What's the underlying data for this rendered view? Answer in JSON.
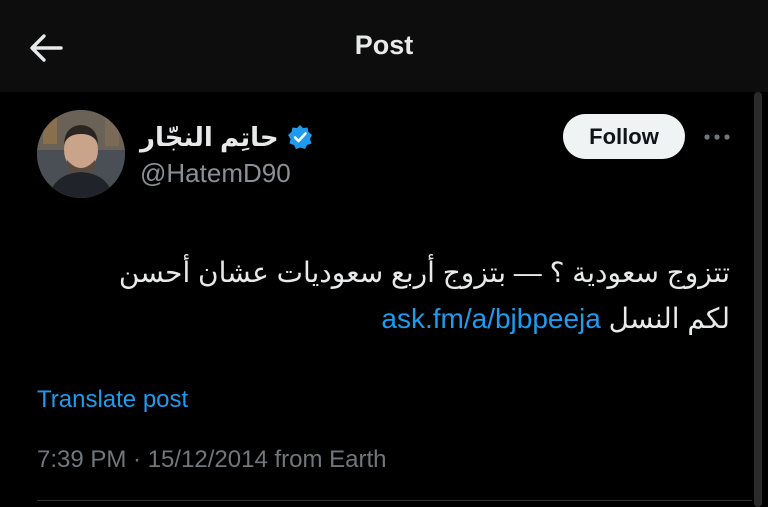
{
  "header": {
    "title": "Post"
  },
  "author": {
    "display_name": "حاتِم النجّار",
    "handle": "@HatemD90",
    "verified": true
  },
  "actions": {
    "follow_label": "Follow"
  },
  "tweet": {
    "text_line1": "تتزوج سعودية ؟ — بتزوج أربع سعوديات عشان أحسن",
    "text_line2_prefix": "لكم النسل",
    "link": "ask.fm/a/bjbpeeja",
    "translate_label": "Translate post",
    "meta": "7:39 PM · 15/12/2014 from Earth"
  },
  "colors": {
    "background": "#000000",
    "link": "#1d9bf0",
    "verified_badge": "#1d9bf0",
    "follow_button_bg": "#eff3f4",
    "secondary_text": "#71767b"
  },
  "icons": [
    "back-arrow-icon",
    "verified-badge-icon",
    "more-options-icon"
  ]
}
